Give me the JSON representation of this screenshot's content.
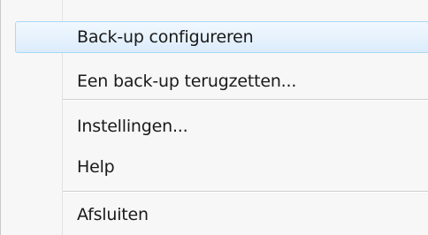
{
  "menu": {
    "items": [
      {
        "label": "Back-up configureren",
        "state": "highlighted"
      },
      {
        "label": "Een back-up terugzetten..."
      },
      {
        "label": "Instellingen..."
      },
      {
        "label": "Help"
      },
      {
        "label": "Afsluiten"
      }
    ]
  },
  "colors": {
    "menu_background": "#f7f7f7",
    "highlight_border": "#a8d8f5",
    "highlight_fill": "#e8f3fd",
    "separator": "#cfcfcf",
    "text": "#1a1a1a"
  }
}
